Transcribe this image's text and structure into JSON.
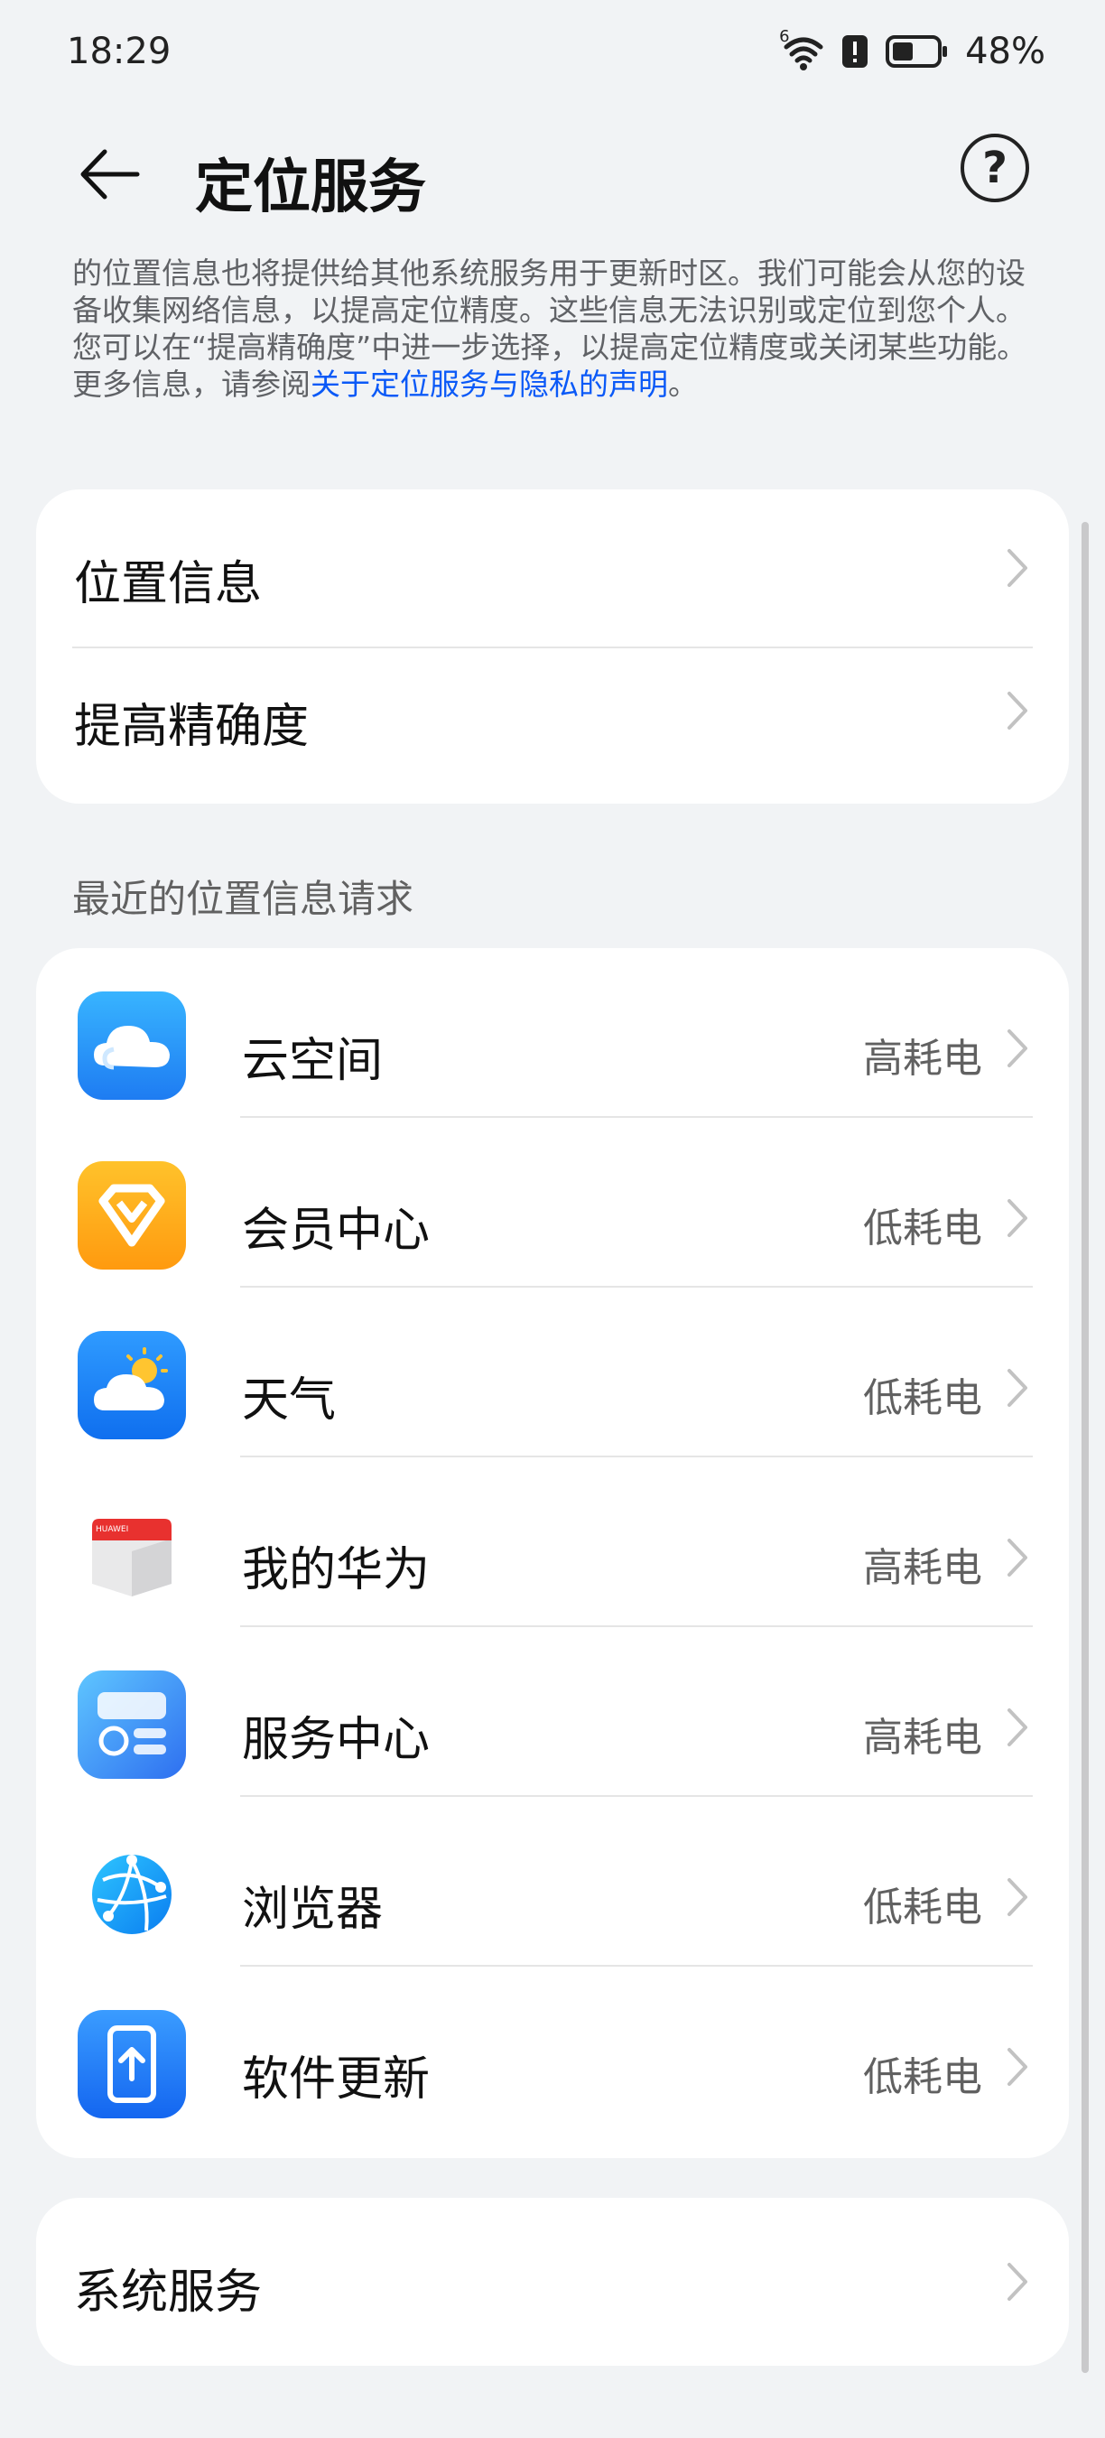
{
  "status_bar": {
    "time": "18:29",
    "wifi_badge": "6",
    "battery_percent": "48%"
  },
  "header": {
    "title": "定位服务",
    "help_symbol": "?"
  },
  "description": {
    "text": "的位置信息也将提供给其他系统服务用于更新时区。我们可能会从您的设备收集网络信息，以提高定位精度。这些信息无法识别或定位到您个人。您可以在“提高精确度”中进一步选择，以提高定位精度或关闭某些功能。更多信息，请参阅",
    "link": "关于定位服务与隐私的声明",
    "suffix": "。"
  },
  "settings": {
    "location_info": "位置信息",
    "improve_accuracy": "提高精确度"
  },
  "recent": {
    "header": "最近的位置信息请求",
    "apps": [
      {
        "name": "云空间",
        "power": "高耗电",
        "icon": "cloud-space-icon"
      },
      {
        "name": "会员中心",
        "power": "低耗电",
        "icon": "member-center-icon"
      },
      {
        "name": "天气",
        "power": "低耗电",
        "icon": "weather-icon"
      },
      {
        "name": "我的华为",
        "power": "高耗电",
        "icon": "my-huawei-icon",
        "icon_text": "HUAWEI"
      },
      {
        "name": "服务中心",
        "power": "高耗电",
        "icon": "service-center-icon"
      },
      {
        "name": "浏览器",
        "power": "低耗电",
        "icon": "browser-icon"
      },
      {
        "name": "软件更新",
        "power": "低耗电",
        "icon": "software-update-icon"
      }
    ]
  },
  "system_services": "系统服务",
  "colors": {
    "background": "#f1f3f5",
    "card": "#ffffff",
    "link": "#0a59f7",
    "secondary_text": "#616161"
  }
}
